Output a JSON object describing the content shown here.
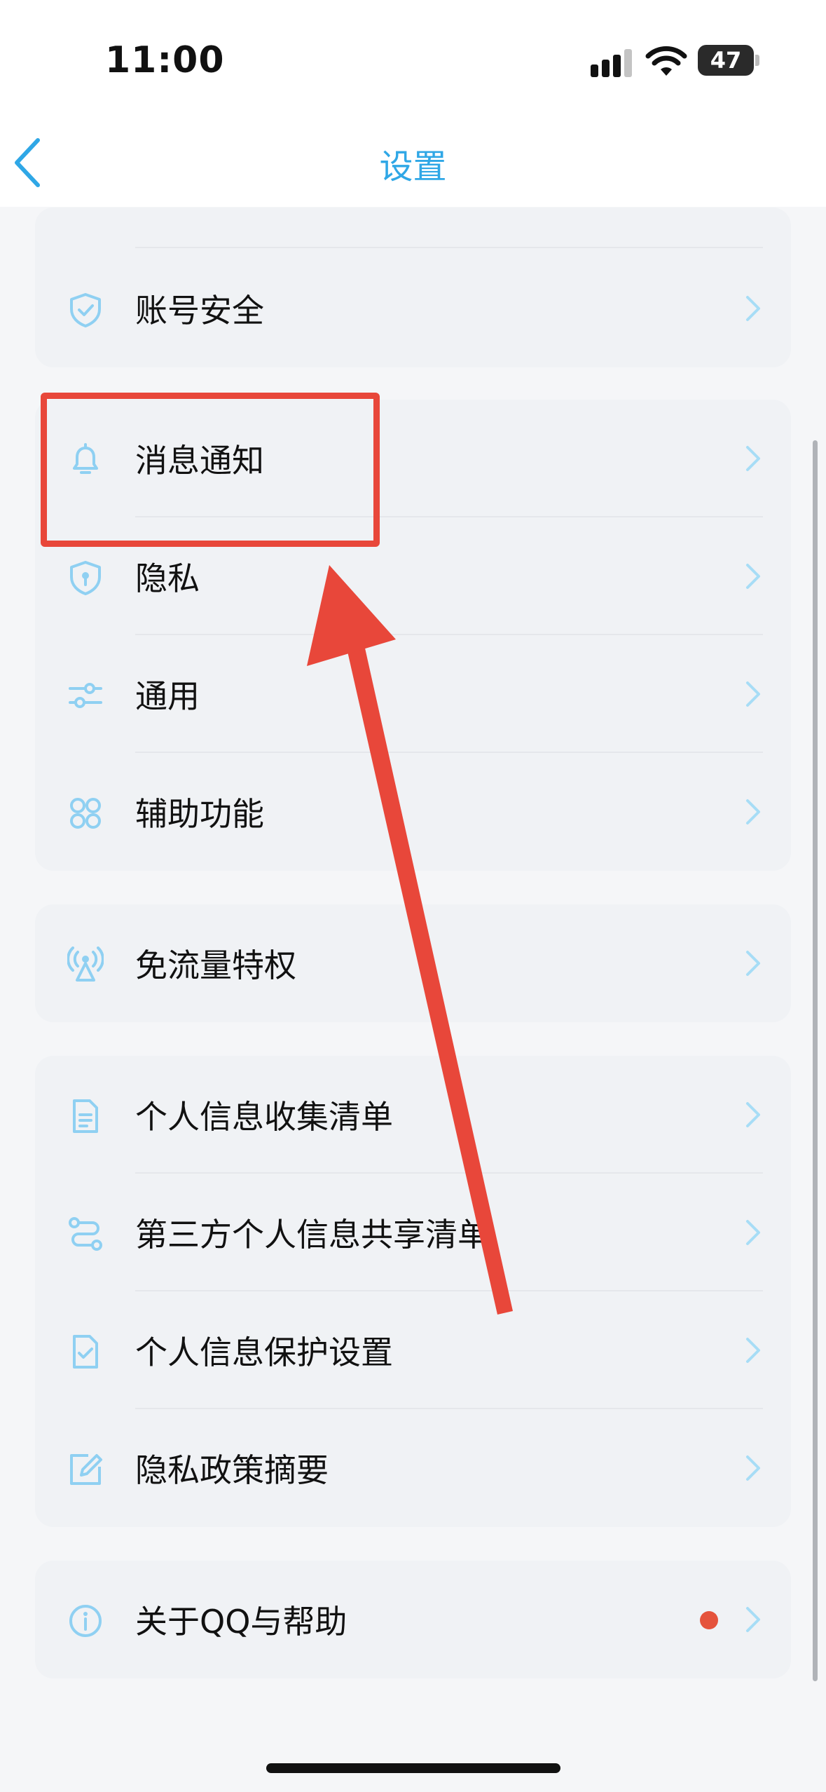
{
  "status_bar": {
    "time": "11:00",
    "battery": "47",
    "icons": [
      "signal-icon",
      "wifi-icon",
      "battery-icon"
    ]
  },
  "nav": {
    "title": "设置",
    "back_icon": "chevron-left-icon"
  },
  "groups": [
    {
      "items": [
        {
          "label": "账号安全",
          "icon": "shield-check-icon"
        }
      ]
    },
    {
      "items": [
        {
          "label": "消息通知",
          "icon": "bell-icon"
        },
        {
          "label": "隐私",
          "icon": "shield-lock-icon"
        },
        {
          "label": "通用",
          "icon": "sliders-icon"
        },
        {
          "label": "辅助功能",
          "icon": "grid-circles-icon"
        }
      ]
    },
    {
      "items": [
        {
          "label": "免流量特权",
          "icon": "broadcast-icon"
        }
      ]
    },
    {
      "items": [
        {
          "label": "个人信息收集清单",
          "icon": "document-icon"
        },
        {
          "label": "第三方个人信息共享清单",
          "icon": "share-flow-icon"
        },
        {
          "label": "个人信息保护设置",
          "icon": "checklist-icon"
        },
        {
          "label": "隐私政策摘要",
          "icon": "edit-icon"
        }
      ]
    },
    {
      "items": [
        {
          "label": "关于QQ与帮助",
          "icon": "info-icon",
          "badge": "red-dot"
        }
      ]
    }
  ],
  "colors": {
    "accent": "#2fa7e6",
    "icon": "#8fd0f2",
    "annotation": "#e8473a",
    "badge": "#e5533c"
  }
}
